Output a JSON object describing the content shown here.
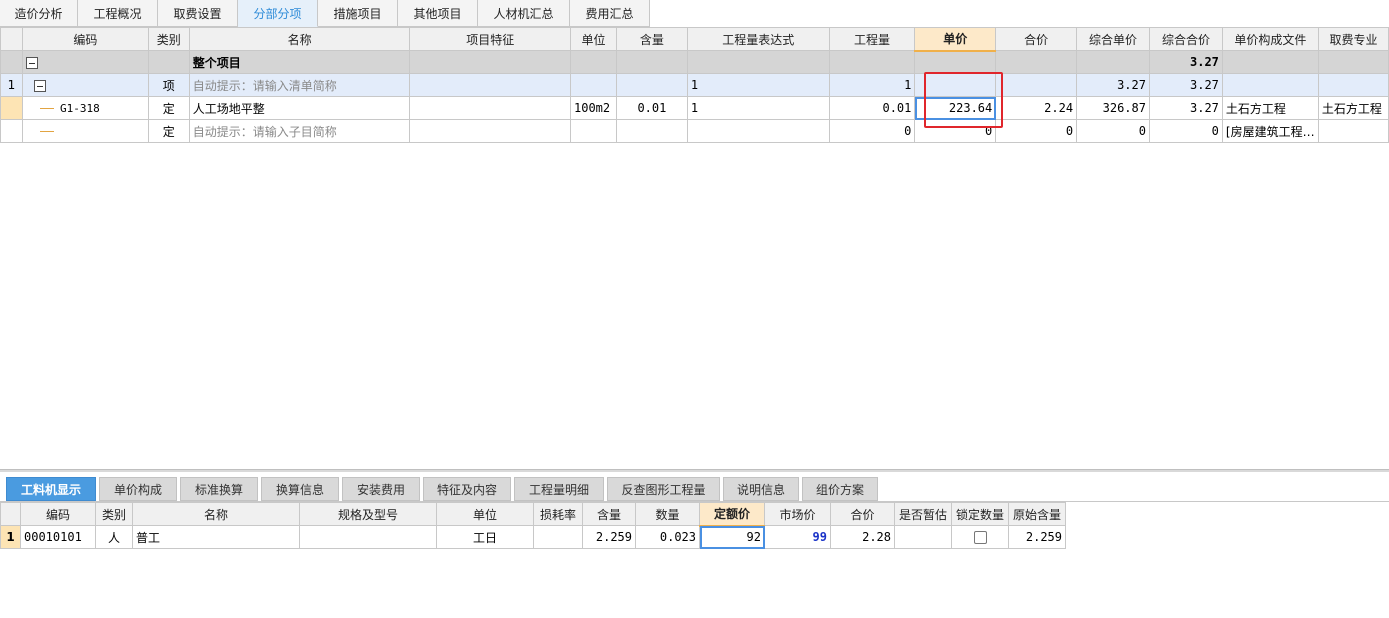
{
  "top_tabs": [
    {
      "label": "造价分析"
    },
    {
      "label": "工程概况"
    },
    {
      "label": "取费设置"
    },
    {
      "label": "分部分项"
    },
    {
      "label": "措施项目"
    },
    {
      "label": "其他项目"
    },
    {
      "label": "人材机汇总"
    },
    {
      "label": "费用汇总"
    }
  ],
  "active_top_tab": "分部分项",
  "main_grid": {
    "headers": [
      "编码",
      "类别",
      "名称",
      "项目特征",
      "单位",
      "含量",
      "工程量表达式",
      "工程量",
      "单价",
      "合价",
      "综合单价",
      "综合合价",
      "单价构成文件",
      "取费专业"
    ],
    "highlight_header": "单价",
    "total_row": {
      "name": "整个项目",
      "comp_total": "3.27"
    },
    "rows": [
      {
        "row_no": "1",
        "code": "",
        "type": "项",
        "name": "自动提示：请输入清单简称",
        "feature": "",
        "unit": "",
        "content": "",
        "expr": "1",
        "qty": "1",
        "price": "",
        "total": "",
        "comp_price": "3.27",
        "comp_total": "3.27",
        "file": "",
        "specialty": ""
      },
      {
        "row_no": "",
        "code": "G1-318",
        "type": "定",
        "name": "人工场地平整",
        "feature": "",
        "unit": "100m2",
        "content": "0.01",
        "expr": "1",
        "qty": "0.01",
        "price": "223.64",
        "total": "2.24",
        "comp_price": "326.87",
        "comp_total": "3.27",
        "file": "土石方工程",
        "specialty": "土石方工程"
      },
      {
        "row_no": "",
        "code": "",
        "type": "定",
        "name": "自动提示：请输入子目简称",
        "feature": "",
        "unit": "",
        "content": "",
        "expr": "",
        "qty": "0",
        "price": "0",
        "total": "0",
        "comp_price": "0",
        "comp_total": "0",
        "file": "[房屋建筑工程…",
        "specialty": ""
      }
    ]
  },
  "bottom_tabs": [
    {
      "label": "工料机显示"
    },
    {
      "label": "单价构成"
    },
    {
      "label": "标准换算"
    },
    {
      "label": "换算信息"
    },
    {
      "label": "安装费用"
    },
    {
      "label": "特征及内容"
    },
    {
      "label": "工程量明细"
    },
    {
      "label": "反查图形工程量"
    },
    {
      "label": "说明信息"
    },
    {
      "label": "组价方案"
    }
  ],
  "active_bottom_tab": "工料机显示",
  "sub_grid": {
    "headers": [
      "编码",
      "类别",
      "名称",
      "规格及型号",
      "单位",
      "损耗率",
      "含量",
      "数量",
      "定额价",
      "市场价",
      "合价",
      "是否暂估",
      "锁定数量",
      "原始含量"
    ],
    "highlight_header": "定额价",
    "rows": [
      {
        "row_no": "1",
        "code": "00010101",
        "type": "人",
        "name": "普工",
        "spec": "",
        "unit": "工日",
        "loss": "",
        "content": "2.259",
        "qty": "0.023",
        "quota_price": "92",
        "market_price": "99",
        "total": "2.28",
        "provisional": "",
        "lock_qty": false,
        "orig_content": "2.259"
      }
    ]
  },
  "colors": {
    "accent": "#4a9be0",
    "highlight": "#e0262c",
    "selected_row": "#fde4b4"
  }
}
